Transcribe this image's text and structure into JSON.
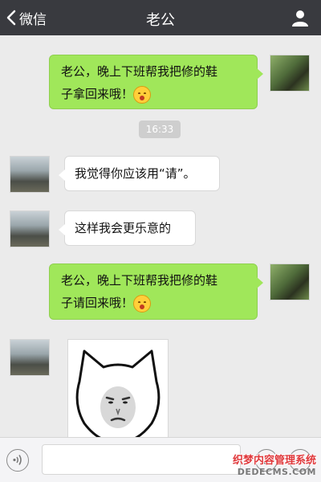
{
  "header": {
    "back_label": "微信",
    "title": "老公",
    "back_icon": "chevron-left-icon",
    "profile_icon": "person-icon"
  },
  "timestamp": "16:33",
  "messages": [
    {
      "sender": "me",
      "lines": [
        "老公，晚上下班帮我把修的鞋",
        "子拿回来哦！"
      ],
      "emoji": "smile-emoji"
    },
    {
      "sender": "other",
      "lines": [
        "我觉得你应该用“请”。"
      ]
    },
    {
      "sender": "other",
      "lines": [
        "这样我会更乐意的"
      ]
    },
    {
      "sender": "me",
      "lines": [
        "老公，晚上下班帮我把修的鞋",
        "子请回来哦！"
      ],
      "emoji": "smile-emoji"
    },
    {
      "sender": "other",
      "type": "sticker",
      "sticker": "cat-face-meme"
    }
  ],
  "input_bar": {
    "voice_icon": "voice-icon",
    "emoji_icon": "emoji-icon",
    "plus_icon": "plus-icon",
    "placeholder": ""
  },
  "watermark": {
    "line1": "织梦内容管理系统",
    "line2": "DEDECMS.COM"
  },
  "colors": {
    "header_bg": "#393a3f",
    "chat_bg": "#ebebeb",
    "my_bubble": "#a0e75a",
    "their_bubble": "#ffffff"
  }
}
